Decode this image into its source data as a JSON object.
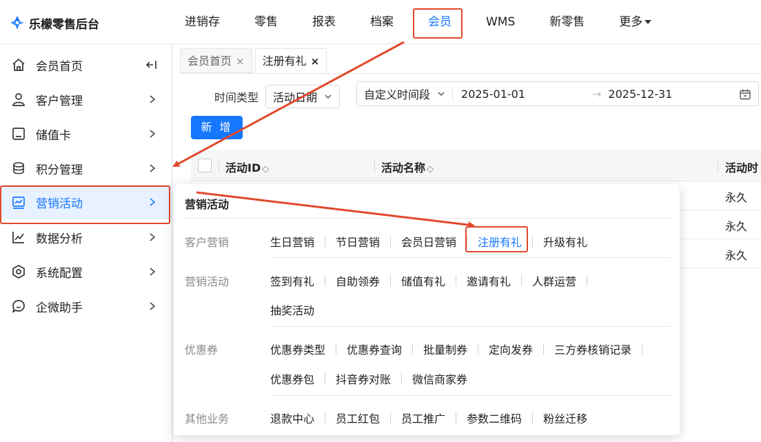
{
  "brand": {
    "name": "乐檬零售后台",
    "color": "#1677ff"
  },
  "topnav": [
    {
      "label": "进销存"
    },
    {
      "label": "零售"
    },
    {
      "label": "报表"
    },
    {
      "label": "档案"
    },
    {
      "label": "会员",
      "active": true
    },
    {
      "label": "WMS"
    },
    {
      "label": "新零售"
    },
    {
      "label": "更多"
    }
  ],
  "sidebar": {
    "items": [
      {
        "label": "会员首页",
        "icon": "home-icon"
      },
      {
        "label": "客户管理",
        "icon": "user-icon"
      },
      {
        "label": "储值卡",
        "icon": "card-icon"
      },
      {
        "label": "积分管理",
        "icon": "coins-icon"
      },
      {
        "label": "营销活动",
        "icon": "chart-board-icon",
        "active": true
      },
      {
        "label": "数据分析",
        "icon": "line-chart-icon"
      },
      {
        "label": "系统配置",
        "icon": "settings-hex-icon"
      },
      {
        "label": "企微助手",
        "icon": "chat-icon"
      }
    ]
  },
  "tabs": [
    {
      "label": "会员首页",
      "close": "×"
    },
    {
      "label": "注册有礼",
      "close": "×",
      "active": true
    }
  ],
  "filter": {
    "label": "时间类型",
    "type_value": "活动日期",
    "range_type": "自定义时间段",
    "start_date": "2025-01-01",
    "arrow": "→",
    "end_date": "2025-12-31"
  },
  "add_button": "新 增",
  "table": {
    "columns": [
      "活动ID",
      "活动名称",
      "活动时"
    ],
    "sort_glyph": "◇",
    "rows": [
      {
        "time": "永久"
      },
      {
        "time": "永久"
      },
      {
        "time": "永久"
      }
    ]
  },
  "popover": {
    "title": "营销活动",
    "groups": [
      {
        "category": "客户营销",
        "rows": [
          [
            "生日营销",
            "节日营销",
            "会员日营销",
            "注册有礼",
            "升级有礼"
          ]
        ]
      },
      {
        "category": "营销活动",
        "rows": [
          [
            "签到有礼",
            "自助领券",
            "储值有礼",
            "邀请有礼",
            "人群运营"
          ],
          [
            "抽奖活动"
          ]
        ]
      },
      {
        "category": "优惠券",
        "rows": [
          [
            "优惠券类型",
            "优惠券查询",
            "批量制券",
            "定向发券",
            "三方券核销记录"
          ],
          [
            "优惠券包",
            "抖音券对账",
            "微信商家券"
          ]
        ]
      },
      {
        "category": "其他业务",
        "rows": [
          [
            "退款中心",
            "员工红包",
            "员工推广",
            "参数二维码",
            "粉丝迁移"
          ]
        ]
      }
    ],
    "selected": "注册有礼"
  },
  "colors": {
    "accent": "#1677ff",
    "annotation": "#e2472a"
  }
}
